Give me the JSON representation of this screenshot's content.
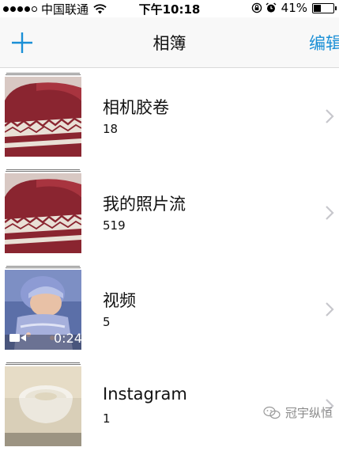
{
  "status_bar": {
    "carrier": "中国联通",
    "time": "下午10:18",
    "battery": "41%",
    "battery_level": 0.41,
    "signal_strength": 4,
    "signal_max": 5
  },
  "nav": {
    "title": "相簿",
    "edit_label": "编辑",
    "add_icon": "plus-icon"
  },
  "albums": [
    {
      "name": "相机胶卷",
      "count": "18"
    },
    {
      "name": "我的照片流",
      "count": "519"
    },
    {
      "name": "视频",
      "count": "5",
      "video_duration": "0:24"
    },
    {
      "name": "Instagram",
      "count": "1"
    }
  ],
  "watermark": {
    "text": "冠宇纵恒"
  },
  "colors": {
    "accent": "#1a8fd6",
    "chevron": "#c7c7cc"
  }
}
